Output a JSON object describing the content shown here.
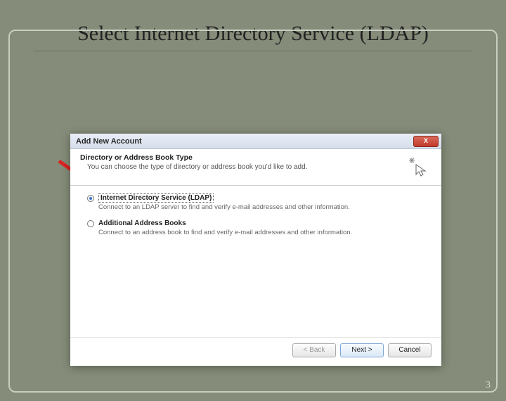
{
  "slide": {
    "title": "Select Internet Directory Service (LDAP)",
    "page_number": "3"
  },
  "dialog": {
    "window_title": "Add New Account",
    "close_label": "X",
    "header_title": "Directory or Address Book Type",
    "header_sub": "You can choose the type of directory or address book you'd like to add.",
    "options": [
      {
        "label": "Internet Directory Service (LDAP)",
        "desc": "Connect to an LDAP server to find and verify e-mail addresses and other information.",
        "selected": true
      },
      {
        "label": "Additional Address Books",
        "desc": "Connect to an address book to find and verify e-mail addresses and other information.",
        "selected": false
      }
    ],
    "buttons": {
      "back": "< Back",
      "next": "Next >",
      "cancel": "Cancel"
    }
  }
}
